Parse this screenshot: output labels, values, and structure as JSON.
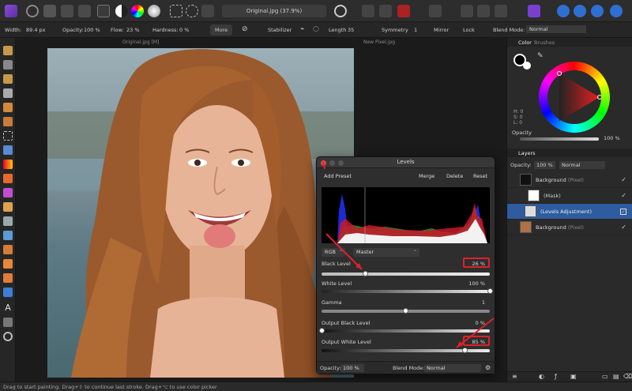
{
  "toolbar": {
    "doc_title": "Original.jpg (37.9%)",
    "icons": [
      "app-logo-icon",
      "persona-photo-icon",
      "persona-liquify-icon",
      "persona-develop-icon",
      "persona-export-icon",
      "adjustments-icon",
      "levels-circle-icon",
      "color-wheel-icon",
      "hsl-icon",
      "selection-rect-icon",
      "selection-brush-icon",
      "quick-mask-icon",
      "selection-icon",
      "align-icon",
      "transform-icon",
      "snapping-icon",
      "assistant-icon",
      "erase-icon",
      "dodge-icon",
      "text-icon",
      "studio-icon",
      "layers-icon",
      "help-icon"
    ]
  },
  "context": {
    "width_label": "Width:",
    "width_value": "89.4 px",
    "opacity_label": "Opacity:",
    "opacity_value": "100 %",
    "flow_label": "Flow:",
    "flow_value": "23 %",
    "hardness_label": "Hardness:",
    "hardness_value": "0 %",
    "more_label": "More",
    "stabilizer_label": "Stabilizer",
    "length_label": "Length",
    "length_value": "35",
    "symmetry_label": "Symmetry",
    "symmetry_value": "1",
    "mirror_label": "Mirror",
    "lock_label": "Lock",
    "blend_label": "Blend Mode:",
    "blend_value": "Normal"
  },
  "doc_tabs": {
    "active": "Original.jpg [M]",
    "inactive": "New Pixel.jpg"
  },
  "color_panel": {
    "tab_color": "Color",
    "tab_brushes": "Brushes",
    "h": "H: 0",
    "s": "S: 0",
    "l": "L: 0",
    "opacity_label": "Opacity",
    "opacity_value": "100 %"
  },
  "layers_panel": {
    "title": "Layers",
    "opacity_label": "Opacity:",
    "opacity_value": "100 %",
    "blend_value": "Normal",
    "rows": [
      {
        "name": "Background",
        "kind": "(Pixel)"
      },
      {
        "name": "(Mask)",
        "kind": ""
      },
      {
        "name": "(Levels Adjustment)",
        "kind": ""
      },
      {
        "name": "Background",
        "kind": "(Pixel)"
      }
    ]
  },
  "levels": {
    "title": "Levels",
    "add_preset": "Add Preset",
    "merge": "Merge",
    "delete": "Delete",
    "reset": "Reset",
    "channel": "RGB",
    "mode": "Master",
    "black_level_label": "Black Level",
    "black_level_value": "26 %",
    "black_level": 0.26,
    "white_level_label": "White Level",
    "white_level_value": "100 %",
    "white_level": 1.0,
    "gamma_label": "Gamma",
    "gamma_value": "1",
    "gamma": 0.5,
    "output_black_label": "Output Black Level",
    "output_black_value": "0 %",
    "output_black": 0.0,
    "output_white_label": "Output White Level",
    "output_white_value": "85 %",
    "output_white": 0.85,
    "opacity_label": "Opacity:",
    "opacity_value": "100 %",
    "blend_label": "Blend Mode:",
    "blend_value": "Normal"
  },
  "status": {
    "text": "Drag to start painting. Drag+⇧ to continue last stroke. Drag+⌥ to use color picker"
  }
}
